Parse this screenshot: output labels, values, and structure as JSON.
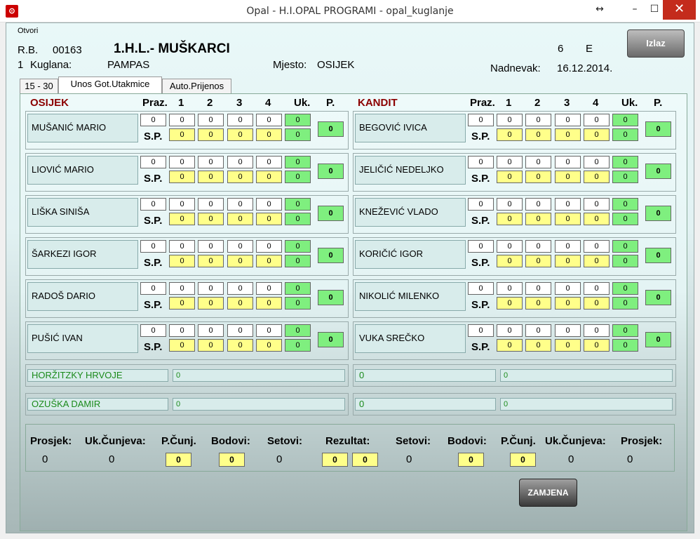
{
  "window": {
    "title": "Opal - H.I.OPAL PROGRAMI - opal_kuglanje",
    "app_icon": "opal-app-icon",
    "controls": {
      "resize": "↔",
      "minimize": "–",
      "maximize": "☐",
      "close": "✕"
    }
  },
  "menu": {
    "open": "Otvori"
  },
  "header": {
    "rb_label": "R.B.",
    "rb_value": "00163",
    "league": "1.H.L.- MUŠKARCI",
    "round": "6",
    "group": "E",
    "row2_num": "1",
    "kuglana_label": "Kuglana:",
    "kuglana_value": "PAMPAS",
    "mjesto_label": "Mjesto:",
    "mjesto_value": "OSIJEK",
    "date_label": "Nadnevak:",
    "date_value": "16.12.2014."
  },
  "exit_button": "Izlaz",
  "tabs": [
    "15 - 30",
    "Unos Got.Utakmice",
    "Auto.Prijenos"
  ],
  "columns": {
    "praz": "Praz.",
    "c1": "1",
    "c2": "2",
    "c3": "3",
    "c4": "4",
    "uk": "Uk.",
    "p": "P.",
    "sp": "S.P."
  },
  "teams": [
    {
      "name": "OSIJEK",
      "players": [
        "MUŠANIĆ MARIO",
        "LIOVIĆ MARIO",
        "LIŠKA SINIŠA",
        "ŠARKEZI IGOR",
        "RADOŠ DARIO",
        "PUŠIĆ IVAN"
      ],
      "subs": [
        {
          "name": "HORŽITZKY HRVOJE",
          "value": "0"
        },
        {
          "name": "OZUŠKA DAMIR",
          "value": "0"
        }
      ]
    },
    {
      "name": "KANDIT",
      "players": [
        "BEGOVIĆ IVICA",
        "JELIČIĆ NEDELJKO",
        "KNEŽEVIĆ VLADO",
        "KORIČIĆ IGOR",
        "NIKOLIĆ MILENKO",
        "VUKA SREČKO"
      ],
      "subs": [
        {
          "name": "0",
          "value": "0"
        },
        {
          "name": "0",
          "value": "0"
        }
      ]
    }
  ],
  "cell_value": "0",
  "summary": {
    "labels": [
      "Prosjek:",
      "Uk.Čunjeva:",
      "P.Čunj.",
      "Bodovi:",
      "Setovi:",
      "Rezultat:",
      "Setovi:",
      "Bodovi:",
      "P.Čunj.",
      "Uk.Čunjeva:",
      "Prosjek:"
    ],
    "values": {
      "prosjek_l": "0",
      "ukc_l": "0",
      "pc_l": "0",
      "bod_l": "0",
      "set_l": "0",
      "rez_l": "0",
      "rez_r": "0",
      "set_r": "0",
      "bod_r": "0",
      "pc_r": "0",
      "ukc_r": "0",
      "prosjek_r": "0"
    }
  },
  "swap_button": "ZAMJENA",
  "colors": {
    "green": "#7fef7f",
    "yellow": "#ffff8a",
    "team_red": "#8b0000",
    "sub_green": "#1a8a1a"
  }
}
